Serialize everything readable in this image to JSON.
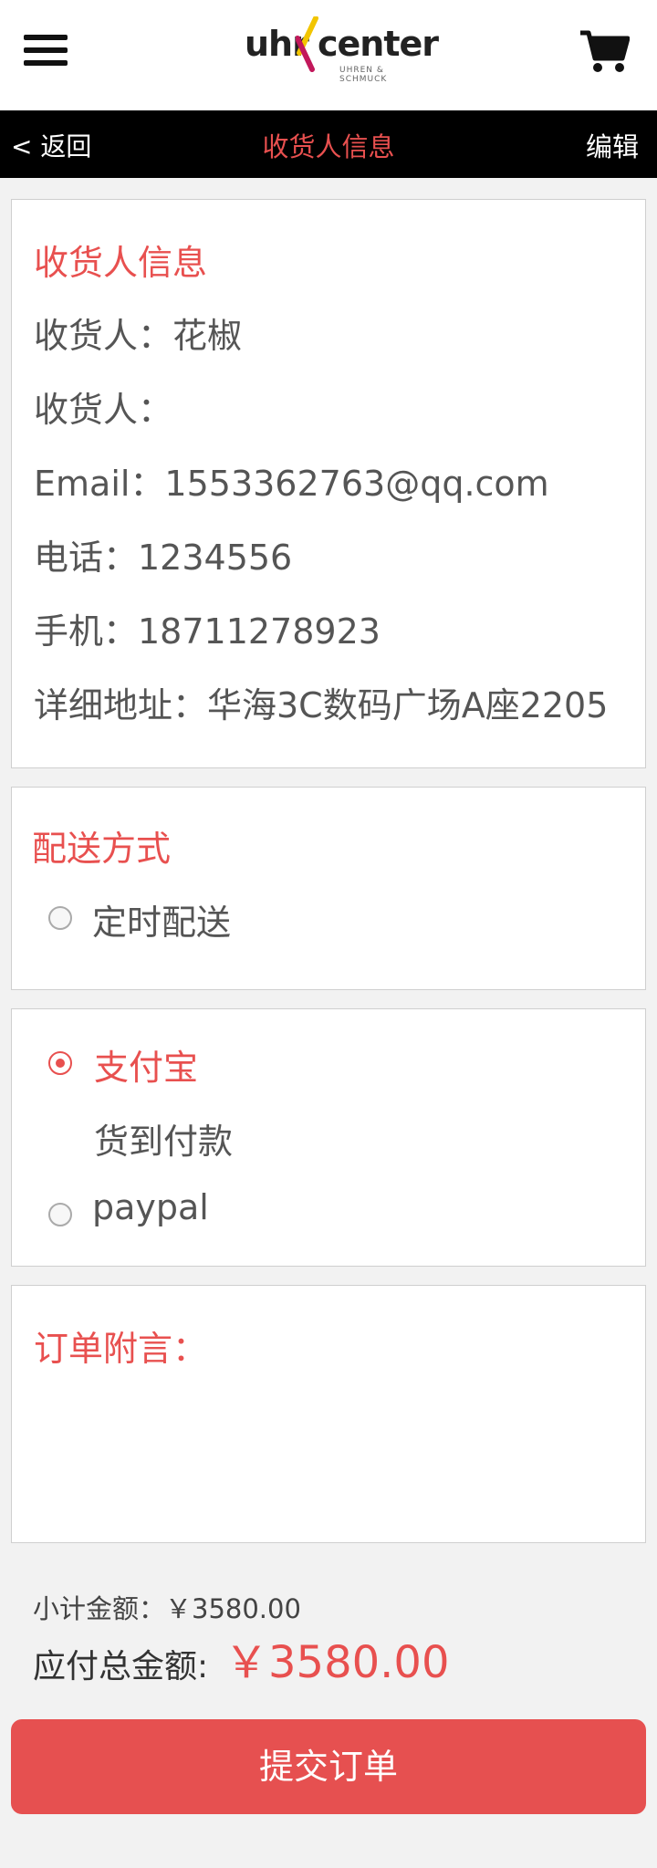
{
  "header": {
    "logo_uhr": "uhr",
    "logo_center": "center",
    "logo_tagline": "UHREN & SCHMUCK"
  },
  "nav": {
    "back_label": "< 返回",
    "title": "收货人信息",
    "edit_label": "编辑"
  },
  "receiver": {
    "section_title": "收货人信息",
    "name_row": "收货人：花椒",
    "name2_row": "收货人：",
    "email_row": "Email：1553362763@qq.com",
    "phone_row": "电话：1234556",
    "mobile_row": "手机：18711278923",
    "address_row": "详细地址：华海3C数码广场A座2205"
  },
  "delivery": {
    "section_title": "配送方式",
    "option_label": "定时配送"
  },
  "payment": {
    "options": [
      {
        "label": "支付宝",
        "checked": true
      },
      {
        "label": "货到付款",
        "checked": false
      },
      {
        "label": "paypal",
        "checked": false
      }
    ]
  },
  "remarks": {
    "section_title": "订单附言："
  },
  "summary": {
    "subtotal_text": "小计金额：￥3580.00",
    "total_label": "应付总金额:",
    "total_value": "￥3580.00"
  },
  "actions": {
    "submit_label": "提交订单"
  },
  "colors": {
    "accent": "#e8504f",
    "button": "#e65050",
    "navbar": "#000000"
  }
}
